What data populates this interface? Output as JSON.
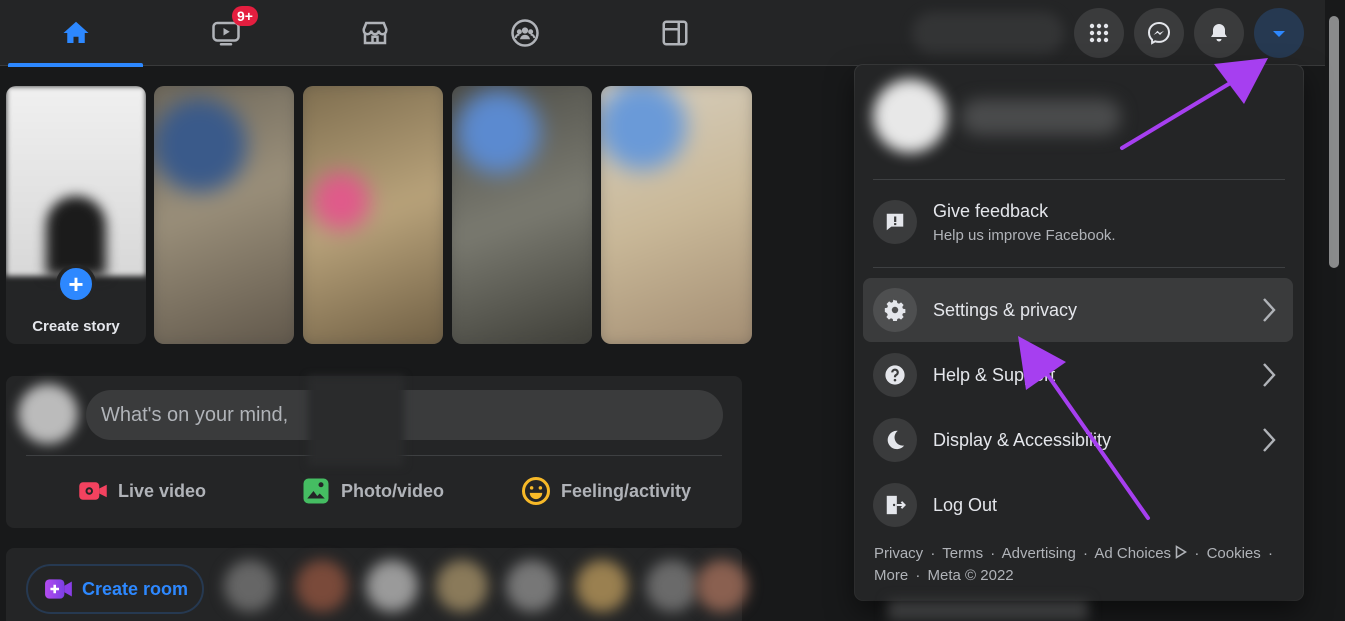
{
  "topbar": {
    "tabs": [
      {
        "name": "home",
        "icon": "home-icon",
        "active": true
      },
      {
        "name": "watch",
        "icon": "video-icon",
        "badge": "9+"
      },
      {
        "name": "marketplace",
        "icon": "store-icon"
      },
      {
        "name": "groups",
        "icon": "groups-icon"
      },
      {
        "name": "gaming",
        "icon": "gaming-icon"
      }
    ],
    "actions": [
      "menu-grid-icon",
      "messenger-icon",
      "bell-icon",
      "caret-down-icon"
    ],
    "accent": "#2d88ff"
  },
  "stories": {
    "create_label": "Create story",
    "plus": "+"
  },
  "composer": {
    "placeholder": "What's on your mind,",
    "placeholder_end": "?",
    "actions": [
      {
        "label": "Live video",
        "color": "#f3425f"
      },
      {
        "label": "Photo/video",
        "color": "#45bd62"
      },
      {
        "label": "Feeling/activity",
        "color": "#f7b928"
      }
    ]
  },
  "rooms": {
    "create_label": "Create room"
  },
  "menu": {
    "items": [
      {
        "label": "Give feedback",
        "sub": "Help us improve Facebook.",
        "icon": "feedback-icon"
      },
      {
        "label": "Settings & privacy",
        "icon": "gear-icon",
        "chevron": true
      },
      {
        "label": "Help & Support",
        "icon": "help-icon",
        "chevron": true
      },
      {
        "label": "Display & Accessibility",
        "icon": "moon-icon",
        "chevron": true
      },
      {
        "label": "Log Out",
        "icon": "logout-icon"
      }
    ],
    "footer": {
      "privacy": "Privacy",
      "terms": "Terms",
      "advertising": "Advertising",
      "ad_choices": "Ad Choices",
      "cookies": "Cookies",
      "more": "More",
      "copyright": "Meta © 2022",
      "dot": "·"
    }
  },
  "annotation_color": "#a63ff0"
}
